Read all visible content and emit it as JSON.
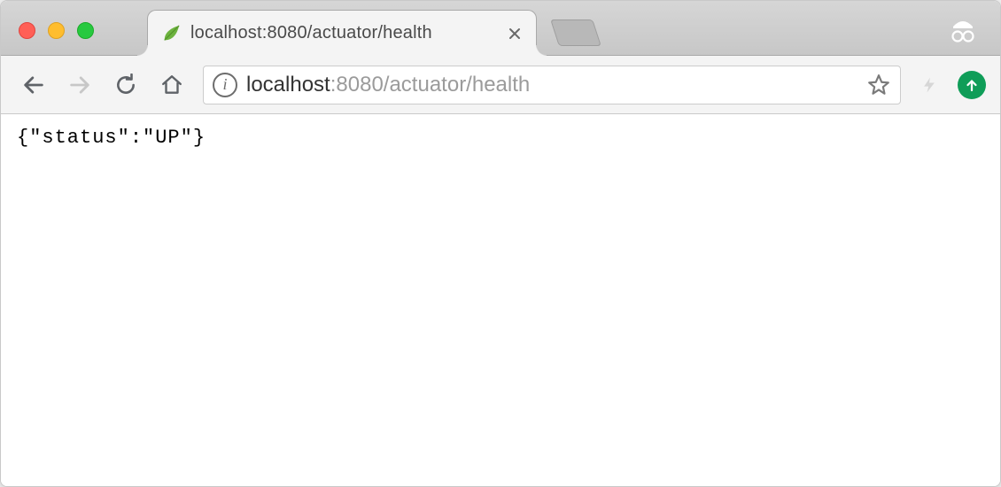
{
  "tab": {
    "title": "localhost:8080/actuator/health",
    "favicon_name": "spring-leaf-icon"
  },
  "address": {
    "host": "localhost",
    "rest": ":8080/actuator/health"
  },
  "page": {
    "body": "{\"status\":\"UP\"}"
  }
}
